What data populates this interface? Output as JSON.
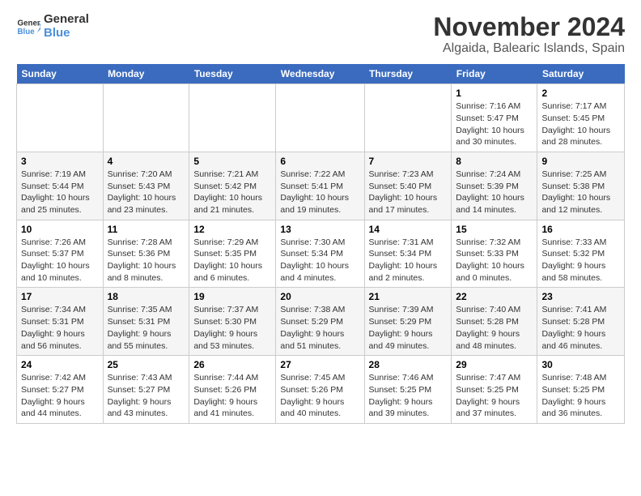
{
  "app": {
    "logo_general": "General",
    "logo_blue": "Blue",
    "title": "November 2024",
    "subtitle": "Algaida, Balearic Islands, Spain"
  },
  "calendar": {
    "headers": [
      "Sunday",
      "Monday",
      "Tuesday",
      "Wednesday",
      "Thursday",
      "Friday",
      "Saturday"
    ],
    "rows": [
      [
        {
          "day": "",
          "info": ""
        },
        {
          "day": "",
          "info": ""
        },
        {
          "day": "",
          "info": ""
        },
        {
          "day": "",
          "info": ""
        },
        {
          "day": "",
          "info": ""
        },
        {
          "day": "1",
          "info": "Sunrise: 7:16 AM\nSunset: 5:47 PM\nDaylight: 10 hours and 30 minutes."
        },
        {
          "day": "2",
          "info": "Sunrise: 7:17 AM\nSunset: 5:45 PM\nDaylight: 10 hours and 28 minutes."
        }
      ],
      [
        {
          "day": "3",
          "info": "Sunrise: 7:19 AM\nSunset: 5:44 PM\nDaylight: 10 hours and 25 minutes."
        },
        {
          "day": "4",
          "info": "Sunrise: 7:20 AM\nSunset: 5:43 PM\nDaylight: 10 hours and 23 minutes."
        },
        {
          "day": "5",
          "info": "Sunrise: 7:21 AM\nSunset: 5:42 PM\nDaylight: 10 hours and 21 minutes."
        },
        {
          "day": "6",
          "info": "Sunrise: 7:22 AM\nSunset: 5:41 PM\nDaylight: 10 hours and 19 minutes."
        },
        {
          "day": "7",
          "info": "Sunrise: 7:23 AM\nSunset: 5:40 PM\nDaylight: 10 hours and 17 minutes."
        },
        {
          "day": "8",
          "info": "Sunrise: 7:24 AM\nSunset: 5:39 PM\nDaylight: 10 hours and 14 minutes."
        },
        {
          "day": "9",
          "info": "Sunrise: 7:25 AM\nSunset: 5:38 PM\nDaylight: 10 hours and 12 minutes."
        }
      ],
      [
        {
          "day": "10",
          "info": "Sunrise: 7:26 AM\nSunset: 5:37 PM\nDaylight: 10 hours and 10 minutes."
        },
        {
          "day": "11",
          "info": "Sunrise: 7:28 AM\nSunset: 5:36 PM\nDaylight: 10 hours and 8 minutes."
        },
        {
          "day": "12",
          "info": "Sunrise: 7:29 AM\nSunset: 5:35 PM\nDaylight: 10 hours and 6 minutes."
        },
        {
          "day": "13",
          "info": "Sunrise: 7:30 AM\nSunset: 5:34 PM\nDaylight: 10 hours and 4 minutes."
        },
        {
          "day": "14",
          "info": "Sunrise: 7:31 AM\nSunset: 5:34 PM\nDaylight: 10 hours and 2 minutes."
        },
        {
          "day": "15",
          "info": "Sunrise: 7:32 AM\nSunset: 5:33 PM\nDaylight: 10 hours and 0 minutes."
        },
        {
          "day": "16",
          "info": "Sunrise: 7:33 AM\nSunset: 5:32 PM\nDaylight: 9 hours and 58 minutes."
        }
      ],
      [
        {
          "day": "17",
          "info": "Sunrise: 7:34 AM\nSunset: 5:31 PM\nDaylight: 9 hours and 56 minutes."
        },
        {
          "day": "18",
          "info": "Sunrise: 7:35 AM\nSunset: 5:31 PM\nDaylight: 9 hours and 55 minutes."
        },
        {
          "day": "19",
          "info": "Sunrise: 7:37 AM\nSunset: 5:30 PM\nDaylight: 9 hours and 53 minutes."
        },
        {
          "day": "20",
          "info": "Sunrise: 7:38 AM\nSunset: 5:29 PM\nDaylight: 9 hours and 51 minutes."
        },
        {
          "day": "21",
          "info": "Sunrise: 7:39 AM\nSunset: 5:29 PM\nDaylight: 9 hours and 49 minutes."
        },
        {
          "day": "22",
          "info": "Sunrise: 7:40 AM\nSunset: 5:28 PM\nDaylight: 9 hours and 48 minutes."
        },
        {
          "day": "23",
          "info": "Sunrise: 7:41 AM\nSunset: 5:28 PM\nDaylight: 9 hours and 46 minutes."
        }
      ],
      [
        {
          "day": "24",
          "info": "Sunrise: 7:42 AM\nSunset: 5:27 PM\nDaylight: 9 hours and 44 minutes."
        },
        {
          "day": "25",
          "info": "Sunrise: 7:43 AM\nSunset: 5:27 PM\nDaylight: 9 hours and 43 minutes."
        },
        {
          "day": "26",
          "info": "Sunrise: 7:44 AM\nSunset: 5:26 PM\nDaylight: 9 hours and 41 minutes."
        },
        {
          "day": "27",
          "info": "Sunrise: 7:45 AM\nSunset: 5:26 PM\nDaylight: 9 hours and 40 minutes."
        },
        {
          "day": "28",
          "info": "Sunrise: 7:46 AM\nSunset: 5:25 PM\nDaylight: 9 hours and 39 minutes."
        },
        {
          "day": "29",
          "info": "Sunrise: 7:47 AM\nSunset: 5:25 PM\nDaylight: 9 hours and 37 minutes."
        },
        {
          "day": "30",
          "info": "Sunrise: 7:48 AM\nSunset: 5:25 PM\nDaylight: 9 hours and 36 minutes."
        }
      ]
    ]
  }
}
